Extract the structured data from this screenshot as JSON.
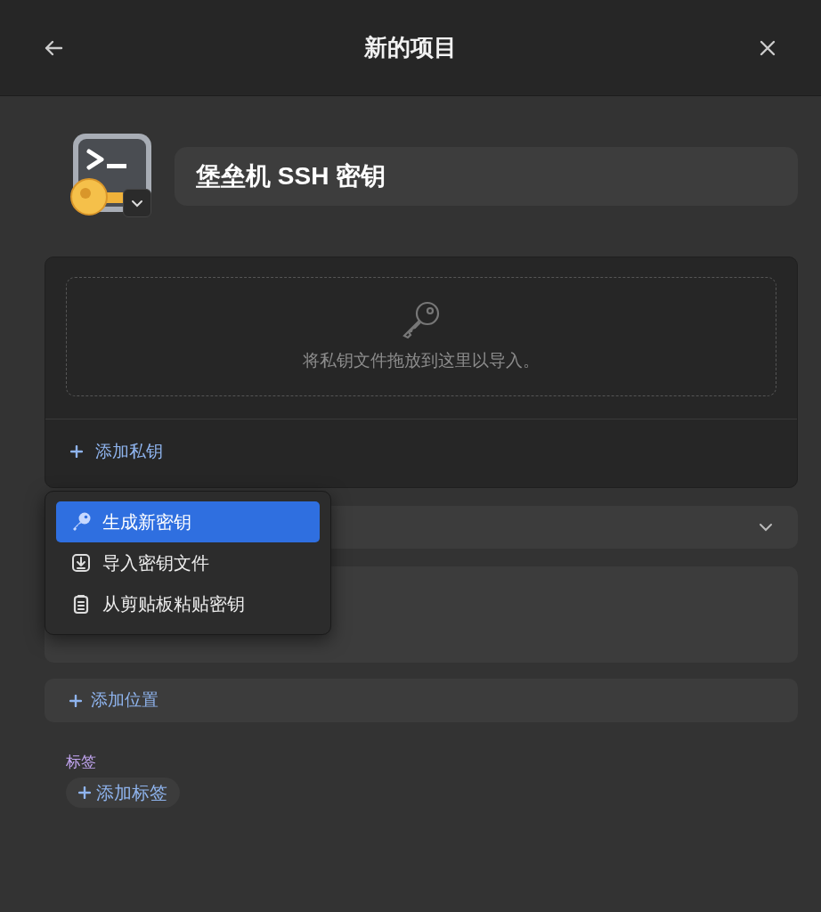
{
  "header": {
    "title": "新的项目"
  },
  "item": {
    "name": "堡垒机 SSH 密钥"
  },
  "key_panel": {
    "drop_hint": "将私钥文件拖放到这里以导入。",
    "add_label": "添加私钥"
  },
  "menu": [
    {
      "label": "生成新密钥",
      "selected": true
    },
    {
      "label": "导入密钥文件",
      "selected": false
    },
    {
      "label": "从剪贴板粘贴密钥",
      "selected": false
    }
  ],
  "add_location": {
    "label": "添加位置"
  },
  "tags": {
    "label": "标签",
    "add_label": "添加标签"
  }
}
